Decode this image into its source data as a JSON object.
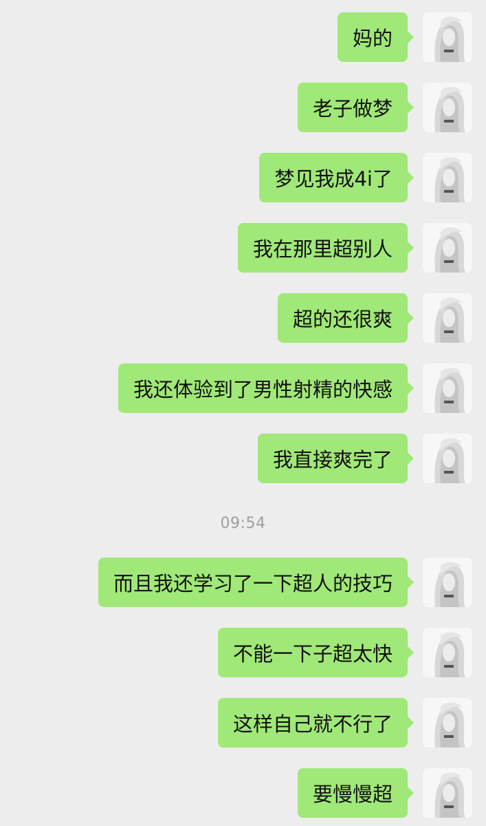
{
  "chat": {
    "theme": {
      "background": "#ededed",
      "bubble_color": "#a0e878",
      "text_color": "#111111",
      "timestamp_color": "#9e9e9e"
    },
    "avatar_icon": "user-avatar-icon",
    "messages": [
      {
        "text": "妈的"
      },
      {
        "text": "老子做梦"
      },
      {
        "text": "梦见我成4i了"
      },
      {
        "text": "我在那里超别人"
      },
      {
        "text": "超的还很爽"
      },
      {
        "text": "我还体验到了男性射精的快感"
      },
      {
        "text": "我直接爽完了"
      },
      {
        "text": "而且我还学习了一下超人的技巧"
      },
      {
        "text": "不能一下子超太快"
      },
      {
        "text": "这样自己就不行了"
      },
      {
        "text": "要慢慢超"
      }
    ],
    "timestamp": "09:54"
  }
}
